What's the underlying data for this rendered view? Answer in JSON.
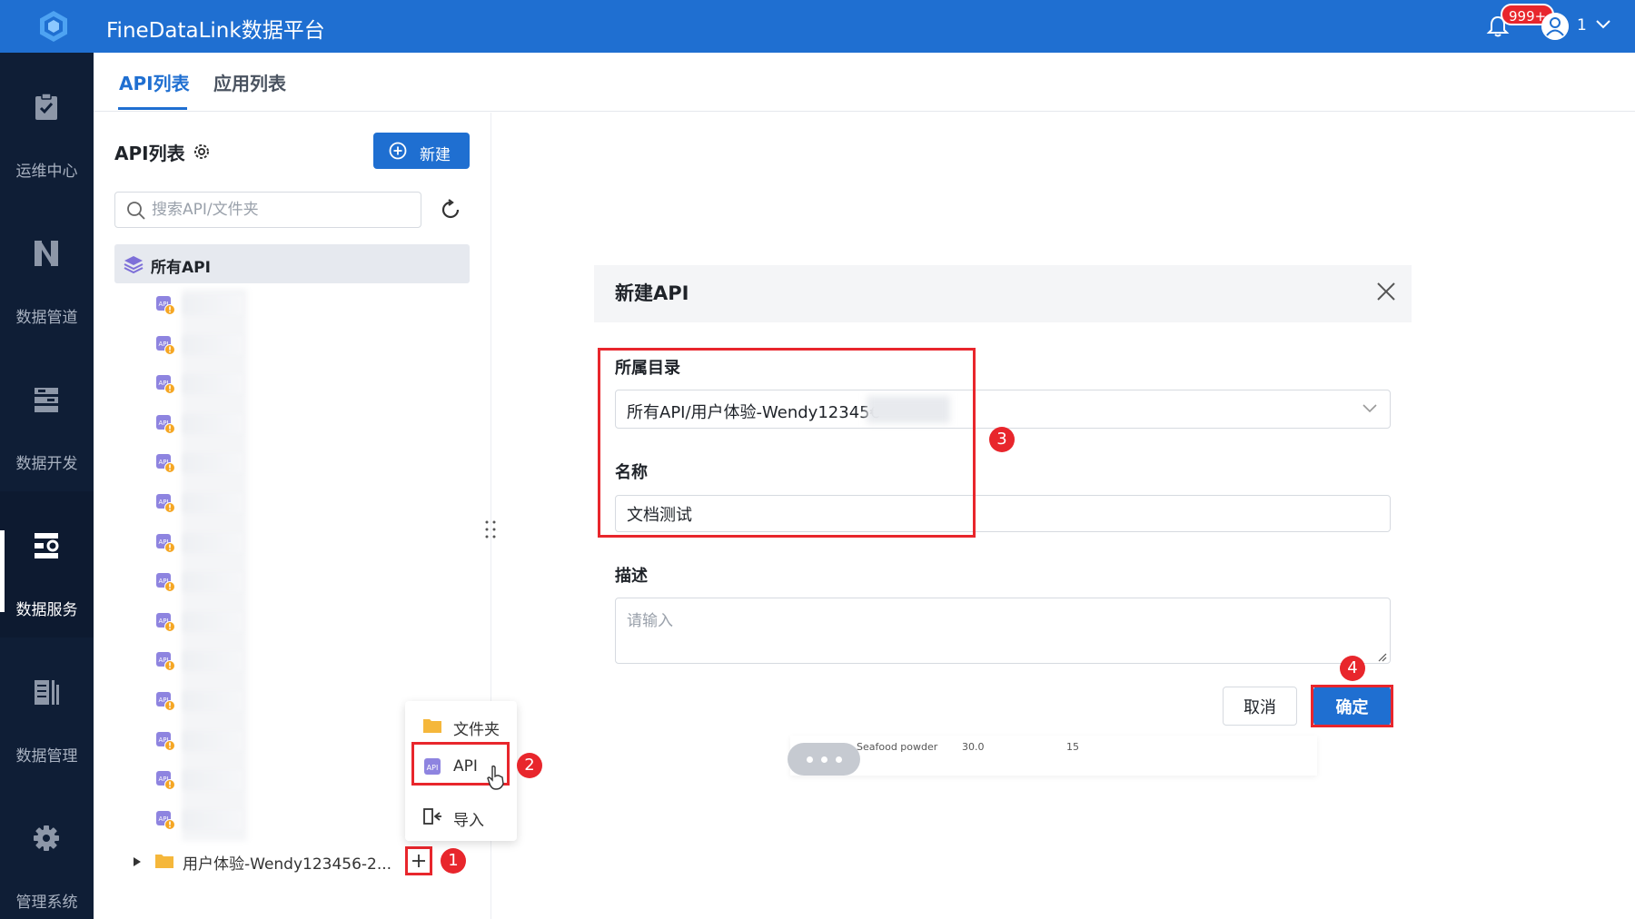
{
  "app": {
    "title": "FineDataLink数据平台"
  },
  "header": {
    "notification_badge": "999+",
    "user_label": "1"
  },
  "sidenav": {
    "items": [
      {
        "label": "运维中心",
        "icon": "clipboard-check-icon",
        "active": false
      },
      {
        "label": "数据管道",
        "icon": "pipeline-icon",
        "active": false
      },
      {
        "label": "数据开发",
        "icon": "dev-stack-icon",
        "active": false
      },
      {
        "label": "数据服务",
        "icon": "service-network-icon",
        "active": true
      },
      {
        "label": "数据管理",
        "icon": "data-bars-icon",
        "active": false
      },
      {
        "label": "管理系统",
        "icon": "gear-icon",
        "active": false
      }
    ]
  },
  "tabs": [
    {
      "label": "API列表",
      "active": true
    },
    {
      "label": "应用列表",
      "active": false
    }
  ],
  "left_panel": {
    "title": "API列表",
    "new_button": "新建",
    "search_placeholder": "搜索API/文件夹",
    "all_api": "所有API",
    "folder_label": "用户体验-Wendy123456-2..."
  },
  "context_menu": {
    "items": [
      {
        "label": "文件夹",
        "icon": "folder-icon"
      },
      {
        "label": "API",
        "icon": "api-icon"
      },
      {
        "label": "导入",
        "icon": "import-icon"
      }
    ]
  },
  "dialog": {
    "title": "新建API",
    "directory_label": "所属目录",
    "directory_value": "所有API/用户体验-Wendy12345€",
    "name_label": "名称",
    "name_value": "文档测试",
    "desc_label": "描述",
    "desc_placeholder": "请输入",
    "cancel_label": "取消",
    "ok_label": "确定"
  },
  "background_card": {
    "item": "Seafood powder",
    "value1": "30.0",
    "value2": "15"
  },
  "markers": [
    "1",
    "2",
    "3",
    "4"
  ],
  "colors": {
    "primary": "#1f6fd1",
    "nav_bg": "#0f1e36",
    "highlight_red": "#e8262c"
  }
}
